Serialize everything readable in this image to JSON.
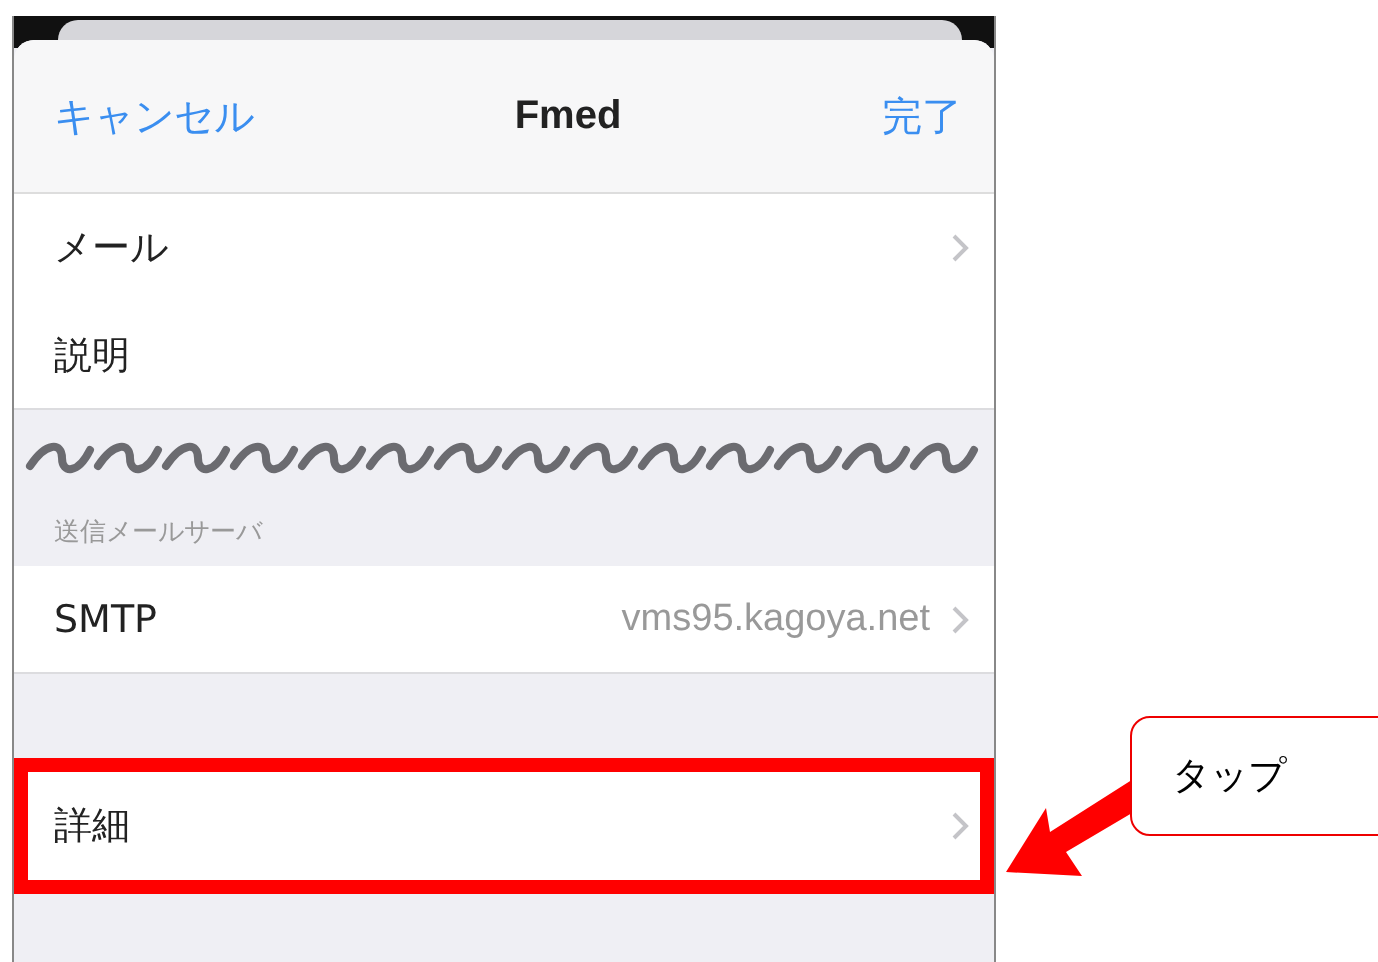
{
  "nav_bar": {
    "cancel": "キャンセル",
    "title": "Fmed",
    "done": "完了"
  },
  "sections": [
    {
      "break_above": false,
      "rows": [
        {
          "label": "メール",
          "value": null,
          "disclosure": true,
          "highlighted": false
        },
        {
          "label": "説明",
          "value": null,
          "disclosure": false,
          "highlighted": false
        }
      ]
    },
    {
      "header": "送信メールサーバ",
      "break_above": true,
      "rows": [
        {
          "label": "SMTP",
          "value": "vms95.kagoya.net",
          "disclosure": true,
          "highlighted": false
        }
      ]
    },
    {
      "break_above": false,
      "rows": [
        {
          "label": "詳細",
          "value": null,
          "disclosure": true,
          "highlighted": true
        }
      ]
    }
  ],
  "callout": {
    "text": "タップ"
  }
}
